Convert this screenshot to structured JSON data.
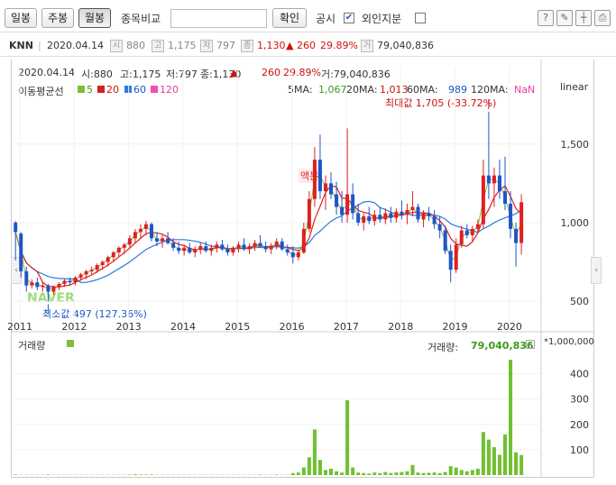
{
  "toolbar": {
    "daily": "일봉",
    "weekly": "주봉",
    "monthly": "월봉",
    "compare_label": "종목비교",
    "confirm": "확인",
    "disclosure": "공시",
    "foreign": "외인지분",
    "disclosure_checked": "✔"
  },
  "info": {
    "code": "KNN",
    "date": "2020.04.14",
    "open_tag": "시",
    "open": "880",
    "high_tag": "고",
    "high": "1,175",
    "low_tag": "저",
    "low": "797",
    "close_tag": "종",
    "close": "1,130",
    "change": "▲ 260",
    "pct": "29.89%",
    "vol_tag": "거",
    "volume": "79,040,836"
  },
  "summary": {
    "date": "2020.04.14",
    "open": "시:880",
    "high": "고:1,175",
    "low": "저:797",
    "close": "종:1,130",
    "arrow": "▲",
    "change": "260",
    "pct": "29.89%",
    "volume": "거:79,040,836"
  },
  "ma": {
    "title": "이동평균선",
    "p5": "5",
    "p20": "20",
    "p60": "60",
    "p120": "120",
    "v5_label": "5MA:",
    "v5": "1,067",
    "v20_label": "20MA:",
    "v20": "1,013",
    "v60_label": "60MA:",
    "v60": "989",
    "v120_label": "120MA:",
    "v120": "NaN",
    "colors": {
      "ma5": "#7bbf3a",
      "ma20": "#d82020",
      "ma60": "#2a7be0",
      "ma120": "#f04fb0"
    }
  },
  "scale_label": "linear",
  "max_label": "최대값 1,705 (-33.72%)",
  "min_label": "최소값 497 (127.36%)",
  "split_label": "액분",
  "watermark": "NAVER",
  "volume_title": "거래량",
  "volume_value_label": "거래량:",
  "volume_value": "79,040,836",
  "volume_unit": "*1,000,000",
  "chart_data": {
    "type": "candlestick",
    "price_ylim": [
      380,
      1820
    ],
    "price_ticks": [
      "1,500",
      "1,000",
      "500"
    ],
    "price_tick_values": [
      1500,
      1000,
      500
    ],
    "volume_ylim": [
      0,
      480
    ],
    "volume_ticks": [
      "400",
      "300",
      "200",
      "100"
    ],
    "volume_tick_values": [
      400,
      300,
      200,
      100
    ],
    "x_ticks": [
      "2011",
      "2012",
      "2013",
      "2014",
      "2015",
      "2016",
      "2017",
      "2018",
      "2019",
      "2020"
    ],
    "x_tick_values": [
      2011,
      2012,
      2013,
      2014,
      2015,
      2016,
      2017,
      2018,
      2019,
      2020
    ],
    "ohlc": [
      [
        2010.92,
        1000,
        1010,
        760,
        940
      ],
      [
        2011.02,
        930,
        940,
        650,
        690
      ],
      [
        2011.12,
        690,
        720,
        560,
        600
      ],
      [
        2011.22,
        600,
        640,
        580,
        620
      ],
      [
        2011.32,
        620,
        650,
        570,
        590
      ],
      [
        2011.42,
        590,
        620,
        560,
        600
      ],
      [
        2011.52,
        600,
        610,
        497,
        560
      ],
      [
        2011.62,
        560,
        600,
        540,
        590
      ],
      [
        2011.72,
        590,
        620,
        570,
        610
      ],
      [
        2011.82,
        610,
        640,
        590,
        630
      ],
      [
        2011.92,
        630,
        650,
        600,
        620
      ],
      [
        2012.02,
        620,
        660,
        600,
        650
      ],
      [
        2012.12,
        650,
        680,
        630,
        670
      ],
      [
        2012.22,
        670,
        700,
        640,
        690
      ],
      [
        2012.32,
        690,
        720,
        670,
        700
      ],
      [
        2012.42,
        700,
        740,
        680,
        730
      ],
      [
        2012.52,
        730,
        760,
        700,
        750
      ],
      [
        2012.62,
        750,
        790,
        720,
        780
      ],
      [
        2012.72,
        780,
        820,
        750,
        810
      ],
      [
        2012.82,
        810,
        850,
        780,
        840
      ],
      [
        2012.92,
        840,
        870,
        800,
        860
      ],
      [
        2013.02,
        860,
        920,
        840,
        900
      ],
      [
        2013.12,
        900,
        960,
        870,
        940
      ],
      [
        2013.22,
        940,
        990,
        900,
        960
      ],
      [
        2013.32,
        960,
        1010,
        920,
        990
      ],
      [
        2013.42,
        990,
        1000,
        880,
        900
      ],
      [
        2013.52,
        900,
        940,
        850,
        880
      ],
      [
        2013.62,
        880,
        920,
        840,
        900
      ],
      [
        2013.72,
        900,
        940,
        860,
        870
      ],
      [
        2013.82,
        870,
        900,
        820,
        840
      ],
      [
        2013.92,
        840,
        880,
        800,
        820
      ],
      [
        2014.02,
        820,
        860,
        790,
        840
      ],
      [
        2014.12,
        840,
        870,
        800,
        810
      ],
      [
        2014.22,
        810,
        850,
        780,
        830
      ],
      [
        2014.32,
        830,
        870,
        800,
        850
      ],
      [
        2014.42,
        850,
        880,
        810,
        820
      ],
      [
        2014.52,
        820,
        860,
        790,
        840
      ],
      [
        2014.62,
        840,
        880,
        810,
        860
      ],
      [
        2014.72,
        860,
        890,
        820,
        830
      ],
      [
        2014.82,
        830,
        860,
        790,
        810
      ],
      [
        2014.92,
        810,
        850,
        790,
        840
      ],
      [
        2015.02,
        840,
        880,
        810,
        860
      ],
      [
        2015.12,
        860,
        900,
        820,
        830
      ],
      [
        2015.22,
        830,
        870,
        800,
        850
      ],
      [
        2015.32,
        850,
        890,
        820,
        870
      ],
      [
        2015.42,
        870,
        920,
        840,
        850
      ],
      [
        2015.52,
        850,
        880,
        810,
        830
      ],
      [
        2015.62,
        830,
        870,
        800,
        850
      ],
      [
        2015.72,
        850,
        900,
        830,
        880
      ],
      [
        2015.82,
        880,
        900,
        820,
        830
      ],
      [
        2015.92,
        830,
        860,
        790,
        810
      ],
      [
        2016.02,
        810,
        850,
        740,
        780
      ],
      [
        2016.12,
        780,
        820,
        760,
        810
      ],
      [
        2016.22,
        810,
        1000,
        800,
        960
      ],
      [
        2016.32,
        960,
        1200,
        940,
        1150
      ],
      [
        2016.42,
        1150,
        1480,
        1100,
        1400
      ],
      [
        2016.52,
        1400,
        1560,
        1150,
        1200
      ],
      [
        2016.62,
        1200,
        1300,
        1080,
        1250
      ],
      [
        2016.72,
        1250,
        1320,
        1150,
        1180
      ],
      [
        2016.82,
        1180,
        1260,
        1050,
        1100
      ],
      [
        2016.92,
        1100,
        1200,
        1000,
        1050
      ],
      [
        2017.02,
        1050,
        1600,
        1000,
        1180
      ],
      [
        2017.12,
        1180,
        1250,
        1020,
        1060
      ],
      [
        2017.22,
        1060,
        1120,
        980,
        1000
      ],
      [
        2017.32,
        1000,
        1060,
        950,
        1040
      ],
      [
        2017.42,
        1040,
        1100,
        990,
        1010
      ],
      [
        2017.52,
        1010,
        1080,
        980,
        1050
      ],
      [
        2017.62,
        1050,
        1100,
        1000,
        1020
      ],
      [
        2017.72,
        1020,
        1090,
        990,
        1060
      ],
      [
        2017.82,
        1060,
        1100,
        1000,
        1030
      ],
      [
        2017.92,
        1030,
        1090,
        1000,
        1070
      ],
      [
        2018.02,
        1070,
        1140,
        1020,
        1050
      ],
      [
        2018.12,
        1050,
        1120,
        990,
        1080
      ],
      [
        2018.22,
        1080,
        1200,
        1040,
        1100
      ],
      [
        2018.32,
        1100,
        1120,
        1000,
        1020
      ],
      [
        2018.42,
        1020,
        1080,
        970,
        1060
      ],
      [
        2018.52,
        1060,
        1100,
        1010,
        1040
      ],
      [
        2018.62,
        1040,
        1080,
        960,
        990
      ],
      [
        2018.72,
        990,
        1040,
        900,
        950
      ],
      [
        2018.82,
        950,
        980,
        800,
        820
      ],
      [
        2018.92,
        820,
        860,
        620,
        700
      ],
      [
        2019.02,
        700,
        900,
        680,
        860
      ],
      [
        2019.12,
        860,
        980,
        840,
        950
      ],
      [
        2019.22,
        950,
        990,
        900,
        920
      ],
      [
        2019.32,
        920,
        980,
        880,
        960
      ],
      [
        2019.42,
        960,
        1020,
        930,
        990
      ],
      [
        2019.52,
        990,
        1400,
        960,
        1300
      ],
      [
        2019.62,
        1300,
        1705,
        1150,
        1250
      ],
      [
        2019.72,
        1250,
        1350,
        1100,
        1300
      ],
      [
        2019.82,
        1300,
        1400,
        1150,
        1200
      ],
      [
        2019.92,
        1200,
        1420,
        1080,
        1120
      ],
      [
        2020.02,
        1120,
        1200,
        900,
        960
      ],
      [
        2020.12,
        960,
        1000,
        720,
        870
      ],
      [
        2020.22,
        870,
        1180,
        797,
        1130
      ]
    ],
    "volume": [
      [
        2010.92,
        2
      ],
      [
        2011.02,
        1
      ],
      [
        2011.12,
        1
      ],
      [
        2011.22,
        1
      ],
      [
        2011.32,
        1
      ],
      [
        2011.42,
        1
      ],
      [
        2011.52,
        2
      ],
      [
        2011.62,
        1
      ],
      [
        2011.72,
        1
      ],
      [
        2011.82,
        1
      ],
      [
        2011.92,
        1
      ],
      [
        2012.02,
        1
      ],
      [
        2012.12,
        1
      ],
      [
        2012.22,
        1
      ],
      [
        2012.32,
        1
      ],
      [
        2012.42,
        1
      ],
      [
        2012.52,
        1
      ],
      [
        2012.62,
        1
      ],
      [
        2012.72,
        1
      ],
      [
        2012.82,
        1
      ],
      [
        2012.92,
        1
      ],
      [
        2013.02,
        2
      ],
      [
        2013.12,
        3
      ],
      [
        2013.22,
        2
      ],
      [
        2013.32,
        2
      ],
      [
        2013.42,
        2
      ],
      [
        2013.52,
        1
      ],
      [
        2013.62,
        1
      ],
      [
        2013.72,
        1
      ],
      [
        2013.82,
        1
      ],
      [
        2013.92,
        1
      ],
      [
        2014.02,
        1
      ],
      [
        2014.12,
        1
      ],
      [
        2014.22,
        1
      ],
      [
        2014.32,
        1
      ],
      [
        2014.42,
        1
      ],
      [
        2014.52,
        1
      ],
      [
        2014.62,
        1
      ],
      [
        2014.72,
        1
      ],
      [
        2014.82,
        1
      ],
      [
        2014.92,
        1
      ],
      [
        2015.02,
        1
      ],
      [
        2015.12,
        1
      ],
      [
        2015.22,
        1
      ],
      [
        2015.32,
        1
      ],
      [
        2015.42,
        2
      ],
      [
        2015.52,
        1
      ],
      [
        2015.62,
        1
      ],
      [
        2015.72,
        2
      ],
      [
        2015.82,
        1
      ],
      [
        2015.92,
        1
      ],
      [
        2016.02,
        8
      ],
      [
        2016.12,
        10
      ],
      [
        2016.22,
        30
      ],
      [
        2016.32,
        70
      ],
      [
        2016.42,
        180
      ],
      [
        2016.52,
        60
      ],
      [
        2016.62,
        20
      ],
      [
        2016.72,
        25
      ],
      [
        2016.82,
        15
      ],
      [
        2016.92,
        10
      ],
      [
        2017.02,
        295
      ],
      [
        2017.12,
        30
      ],
      [
        2017.22,
        10
      ],
      [
        2017.32,
        8
      ],
      [
        2017.42,
        6
      ],
      [
        2017.52,
        10
      ],
      [
        2017.62,
        8
      ],
      [
        2017.72,
        12
      ],
      [
        2017.82,
        8
      ],
      [
        2017.92,
        10
      ],
      [
        2018.02,
        12
      ],
      [
        2018.12,
        15
      ],
      [
        2018.22,
        40
      ],
      [
        2018.32,
        10
      ],
      [
        2018.42,
        8
      ],
      [
        2018.52,
        9
      ],
      [
        2018.62,
        10
      ],
      [
        2018.72,
        8
      ],
      [
        2018.82,
        12
      ],
      [
        2018.92,
        35
      ],
      [
        2019.02,
        30
      ],
      [
        2019.12,
        20
      ],
      [
        2019.22,
        15
      ],
      [
        2019.32,
        20
      ],
      [
        2019.42,
        25
      ],
      [
        2019.52,
        170
      ],
      [
        2019.62,
        140
      ],
      [
        2019.72,
        110
      ],
      [
        2019.82,
        80
      ],
      [
        2019.92,
        160
      ],
      [
        2020.02,
        455
      ],
      [
        2020.12,
        90
      ],
      [
        2020.22,
        79
      ]
    ],
    "markers": [
      {
        "t": "S",
        "x": 2011.2
      },
      {
        "t": "Q",
        "x": 2012.1
      },
      {
        "t": "P",
        "x": 2012.36
      },
      {
        "t": "O",
        "x": 2012.6
      },
      {
        "t": "N",
        "x": 2013.1
      },
      {
        "t": "M",
        "x": 2013.1
      },
      {
        "t": "K",
        "x": 2014.1
      },
      {
        "t": "I",
        "x": 2014.42
      },
      {
        "t": "H",
        "x": 2014.42
      },
      {
        "t": "E",
        "x": 2015.1
      },
      {
        "t": "F",
        "x": 2015.05
      },
      {
        "t": "C",
        "x": 2016.05
      },
      {
        "t": "B",
        "x": 2016.2
      },
      {
        "t": "Z",
        "x": 2016.28
      },
      {
        "t": "Y",
        "x": 2016.5
      },
      {
        "t": "X",
        "x": 2016.5
      },
      {
        "t": "W",
        "x": 2016.5
      },
      {
        "t": "V",
        "x": 2016.5
      },
      {
        "t": "U",
        "x": 2016.8
      },
      {
        "t": "S",
        "x": 2017.0
      },
      {
        "t": "R",
        "x": 2017.1
      },
      {
        "t": "Q",
        "x": 2018.0
      },
      {
        "t": "P",
        "x": 2018.3
      },
      {
        "t": "O",
        "x": 2018.75
      },
      {
        "t": "N",
        "x": 2019.0
      },
      {
        "t": "M",
        "x": 2019.1
      },
      {
        "t": "L",
        "x": 2019.3
      },
      {
        "t": "I",
        "x": 2019.4
      },
      {
        "t": "F",
        "x": 2019.55
      },
      {
        "t": "K",
        "x": 2019.32
      },
      {
        "t": "G",
        "x": 2019.45
      },
      {
        "t": "J",
        "x": 2019.32
      },
      {
        "t": "I",
        "x": 2019.32
      },
      {
        "t": "E",
        "x": 2019.62
      },
      {
        "t": "D",
        "x": 2019.62
      },
      {
        "t": "C",
        "x": 2020.0
      },
      {
        "t": "B",
        "x": 2020.0
      },
      {
        "t": "A",
        "x": 2020.2
      }
    ]
  }
}
